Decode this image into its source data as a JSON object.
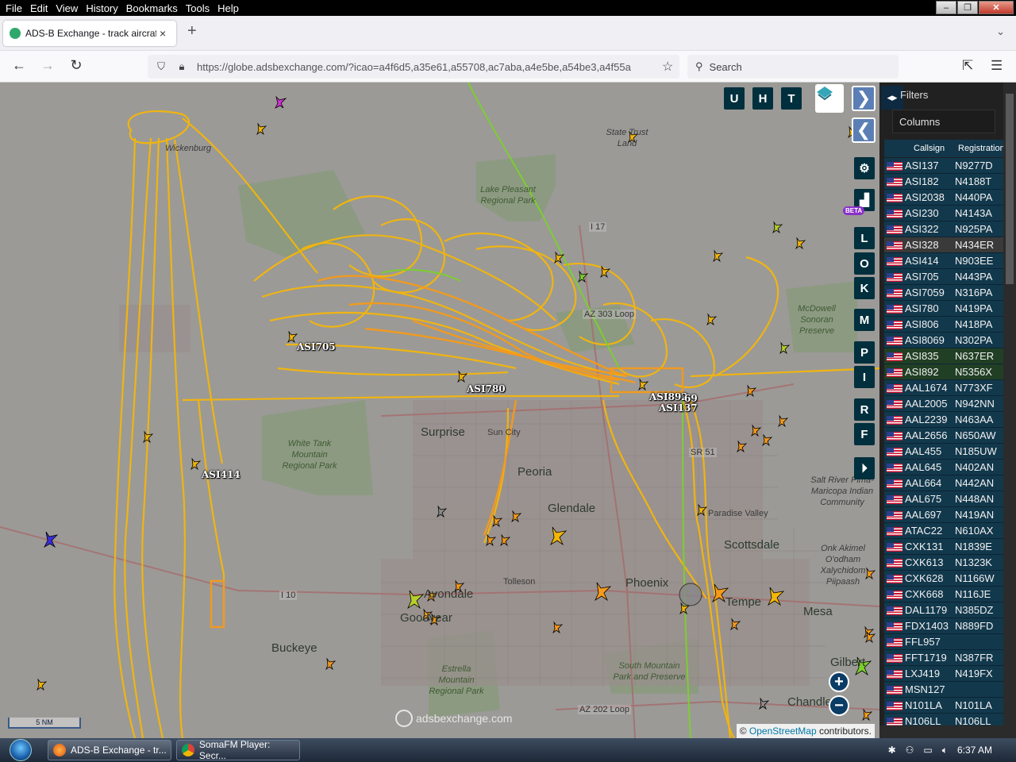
{
  "menu": [
    "File",
    "Edit",
    "View",
    "History",
    "Bookmarks",
    "Tools",
    "Help"
  ],
  "tab": {
    "title": "ADS-B Exchange - track aircraft",
    "close": "×"
  },
  "new_tab": "+",
  "url": "https://globe.adsbexchange.com/?icao=a4f6d5,a35e61,a55708,ac7aba,a4e5be,a54be3,a4f55a",
  "search_placeholder": "Search",
  "map": {
    "places": {
      "wickenburg": "Wickenburg",
      "surprise": "Surprise",
      "sun_city": "Sun City",
      "peoria": "Peoria",
      "glendale": "Glendale",
      "goodyear": "Goodyear",
      "avondale": "Avondale",
      "tolleson": "Tolleson",
      "phoenix": "Phoenix",
      "tempe": "Tempe",
      "mesa": "Mesa",
      "scottsdale": "Scottsdale",
      "paradise_valley": "Paradise Valley",
      "buckeye": "Buckeye",
      "chandler": "Chandler",
      "gilbert": "Gilbert"
    },
    "areas": {
      "state_trust": "State Trust Land",
      "lake_pleasant": "Lake Pleasant Regional Park",
      "white_tank": "White Tank Mountain Regional Park",
      "mcdowell": "McDowell Sonoran Preserve",
      "salt_river": "Salt River Pima-Maricopa Indian Community",
      "onk_akimel": "Onk Akimel O'odham Xalychidom Piipaash",
      "estrella": "Estrella Mountain Regional Park",
      "south_mountain": "South Mountain Park and Preserve"
    },
    "roads": {
      "i17": "I 17",
      "az303": "AZ 303 Loop",
      "i51": "SR 51",
      "i10": "I 10",
      "az202": "AZ 202 Loop"
    },
    "aircraft_labels": {
      "asi705": "ASI705",
      "asi780": "ASI780",
      "asi414": "ASI414",
      "asi892": "ASI892",
      "asi137": "ASI137",
      "n69": "69"
    },
    "buttons": {
      "u": "U",
      "h": "H",
      "t": "T",
      "l": "L",
      "o": "O",
      "k": "K",
      "m": "M",
      "p": "P",
      "i": "I",
      "r": "R",
      "f": "F"
    },
    "beta": "BETA",
    "scale": "5 NM",
    "watermark": "adsbexchange.com",
    "attribution_prefix": "©",
    "attribution_link": "OpenStreetMap",
    "attribution_suffix": "contributors."
  },
  "panel": {
    "filters": "Filters",
    "columns": "Columns",
    "headers": {
      "callsign": "Callsign",
      "registration": "Registration"
    },
    "rows": [
      {
        "callsign": "ASI137",
        "reg": "N9277D"
      },
      {
        "callsign": "ASI182",
        "reg": "N4188T"
      },
      {
        "callsign": "ASI2038",
        "reg": "N440PA"
      },
      {
        "callsign": "ASI230",
        "reg": "N4143A"
      },
      {
        "callsign": "ASI322",
        "reg": "N925PA"
      },
      {
        "callsign": "ASI328",
        "reg": "N434ER"
      },
      {
        "callsign": "ASI414",
        "reg": "N903EE"
      },
      {
        "callsign": "ASI705",
        "reg": "N443PA"
      },
      {
        "callsign": "ASI7059",
        "reg": "N316PA"
      },
      {
        "callsign": "ASI780",
        "reg": "N419PA"
      },
      {
        "callsign": "ASI806",
        "reg": "N418PA"
      },
      {
        "callsign": "ASI8069",
        "reg": "N302PA"
      },
      {
        "callsign": "ASI835",
        "reg": "N637ER"
      },
      {
        "callsign": "ASI892",
        "reg": "N5356X"
      },
      {
        "callsign": "AAL1674",
        "reg": "N773XF"
      },
      {
        "callsign": "AAL2005",
        "reg": "N942NN"
      },
      {
        "callsign": "AAL2239",
        "reg": "N463AA"
      },
      {
        "callsign": "AAL2656",
        "reg": "N650AW"
      },
      {
        "callsign": "AAL455",
        "reg": "N185UW"
      },
      {
        "callsign": "AAL645",
        "reg": "N402AN"
      },
      {
        "callsign": "AAL664",
        "reg": "N442AN"
      },
      {
        "callsign": "AAL675",
        "reg": "N448AN"
      },
      {
        "callsign": "AAL697",
        "reg": "N419AN"
      },
      {
        "callsign": "ATAC22",
        "reg": "N610AX"
      },
      {
        "callsign": "CXK131",
        "reg": "N1839E"
      },
      {
        "callsign": "CXK613",
        "reg": "N1323K"
      },
      {
        "callsign": "CXK628",
        "reg": "N1166W"
      },
      {
        "callsign": "CXK668",
        "reg": "N116JE"
      },
      {
        "callsign": "DAL1179",
        "reg": "N385DZ"
      },
      {
        "callsign": "FDX1403",
        "reg": "N889FD"
      },
      {
        "callsign": "FFL957",
        "reg": ""
      },
      {
        "callsign": "FFT1719",
        "reg": "N387FR"
      },
      {
        "callsign": "LXJ419",
        "reg": "N419FX"
      },
      {
        "callsign": "MSN127",
        "reg": ""
      },
      {
        "callsign": "N101LA",
        "reg": "N101LA"
      },
      {
        "callsign": "N106LL",
        "reg": "N106LL"
      }
    ]
  },
  "taskbar": {
    "items": [
      {
        "label": "ADS-B Exchange - tr..."
      },
      {
        "label": "SomaFM Player: Secr..."
      }
    ],
    "clock": "6:37 AM"
  },
  "colors": {
    "track_main": "#f5b60a",
    "track_orange": "#f59a1a",
    "track_green": "#7bd12a",
    "panel_row": "#12384c",
    "map_btn": "#002f3d"
  }
}
